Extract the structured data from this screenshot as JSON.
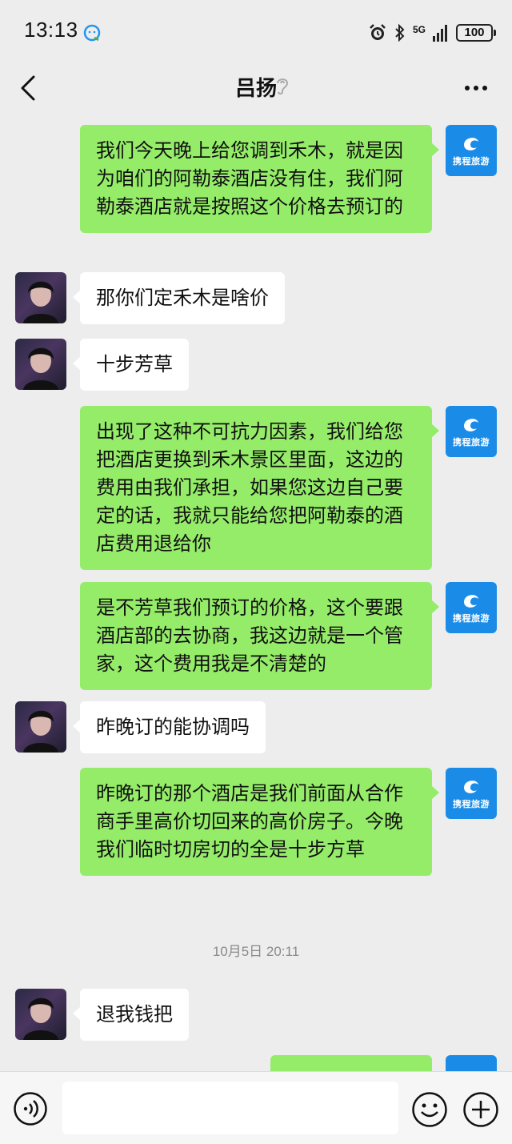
{
  "status_bar": {
    "time": "13:13",
    "network": "5G",
    "battery": "100"
  },
  "header": {
    "title": "吕扬",
    "back_icon": "back-chevron-icon",
    "more_icon": "more-dots-icon"
  },
  "contacts": {
    "agent_avatar_text": "携程旅游"
  },
  "messages": [
    {
      "side": "right",
      "text": "我们今天晚上给您调到禾木，就是因为咱们的阿勒泰酒店没有住，我们阿勒泰酒店就是按照这个价格去预订的"
    },
    {
      "side": "left",
      "text": "那你们定禾木是啥价"
    },
    {
      "side": "left",
      "text": "十步芳草"
    },
    {
      "side": "right",
      "text": "出现了这种不可抗力因素，我们给您把酒店更换到禾木景区里面，这边的费用由我们承担，如果您这边自己要定的话，我就只能给您把阿勒泰的酒店费用退给你"
    },
    {
      "side": "right",
      "text": "是不芳草我们预订的价格，这个要跟酒店部的去协商，我这边就是一个管家，这个费用我是不清楚的"
    },
    {
      "side": "left",
      "text": "昨晚订的能协调吗"
    },
    {
      "side": "right",
      "text": "昨晚订的那个酒店是我们前面从合作商手里高价切回来的高价房子。今晚我们临时切房切的全是十步方草"
    },
    {
      "side": "left",
      "text": "退我钱把"
    }
  ],
  "timestamp": "10月5日 20:11",
  "input_bar": {
    "placeholder": "",
    "voice_icon": "voice-icon",
    "emoji_icon": "emoji-icon",
    "plus_icon": "plus-icon"
  },
  "colors": {
    "background": "#ededed",
    "sent_bubble": "#95ec69",
    "received_bubble": "#ffffff",
    "agent_avatar": "#1a8ce8"
  }
}
